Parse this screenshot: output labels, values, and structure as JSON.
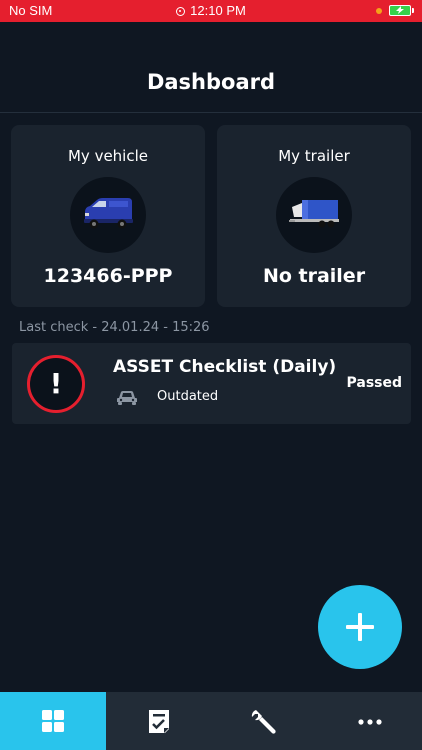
{
  "status_bar": {
    "carrier": "No SIM",
    "time": "12:10 PM",
    "indicator_color": "#f4a21a",
    "battery_color": "#36d14a",
    "background_color": "#e51f2e"
  },
  "header": {
    "title": "Dashboard"
  },
  "cards": {
    "vehicle": {
      "label": "My vehicle",
      "value": "123466-PPP",
      "icon": "van-icon"
    },
    "trailer": {
      "label": "My trailer",
      "value": "No trailer",
      "icon": "trailer-icon"
    }
  },
  "last_check": {
    "text": "Last check - 24.01.24 - 15:26"
  },
  "check_item": {
    "title": "ASSET Checklist (Daily)",
    "subtitle": "Outdated",
    "status": "Passed",
    "alert_symbol": "!",
    "alert_color": "#e51f2e",
    "icon": "car-icon"
  },
  "fab": {
    "icon": "plus-icon",
    "color": "#29c4ec"
  },
  "bottom_nav": {
    "tabs": [
      {
        "icon": "dashboard-grid-icon",
        "active": true
      },
      {
        "icon": "checklist-icon",
        "active": false
      },
      {
        "icon": "wrench-icon",
        "active": false
      },
      {
        "icon": "more-icon",
        "active": false
      }
    ],
    "active_color": "#29c4ec"
  }
}
